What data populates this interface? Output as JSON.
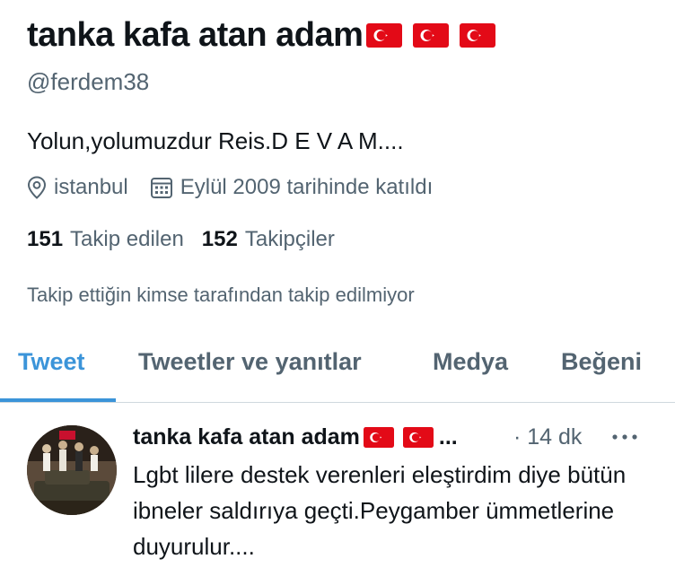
{
  "profile": {
    "display_name": "tanka kafa atan adam",
    "handle": "@ferdem38",
    "bio": "Yolun,yolumuzdur Reis.D E V A M....",
    "location": "istanbul",
    "joined": "Eylül 2009 tarihinde katıldı",
    "following_count": "151",
    "following_label": "Takip edilen",
    "followers_count": "152",
    "followers_label": "Takipçiler",
    "followed_by_text": "Takip ettiğin kimse tarafından takip edilmiyor",
    "flag_icons": [
      "turkey-flag-icon",
      "turkey-flag-icon",
      "turkey-flag-icon"
    ]
  },
  "tabs": [
    {
      "label": "Tweet",
      "active": true
    },
    {
      "label": "Tweetler ve yanıtlar",
      "active": false
    },
    {
      "label": "Medya",
      "active": false
    },
    {
      "label": "Beğeni",
      "active": false
    }
  ],
  "tweet": {
    "author_name": "tanka kafa atan adam",
    "name_ellipsis": "...",
    "time_ago": "· 14 dk",
    "text": "Lgbt lilere destek verenleri eleştirdim diye bütün ibneler saldırıya geçti.Peygamber ümmetlerine duyurulur....",
    "more_icon": "more-horizontal-icon"
  },
  "colors": {
    "accent": "#3b94d9",
    "text_primary": "#0f1419",
    "text_secondary": "#536471",
    "divider": "#cfd9de",
    "flag_red": "#e30a17"
  }
}
